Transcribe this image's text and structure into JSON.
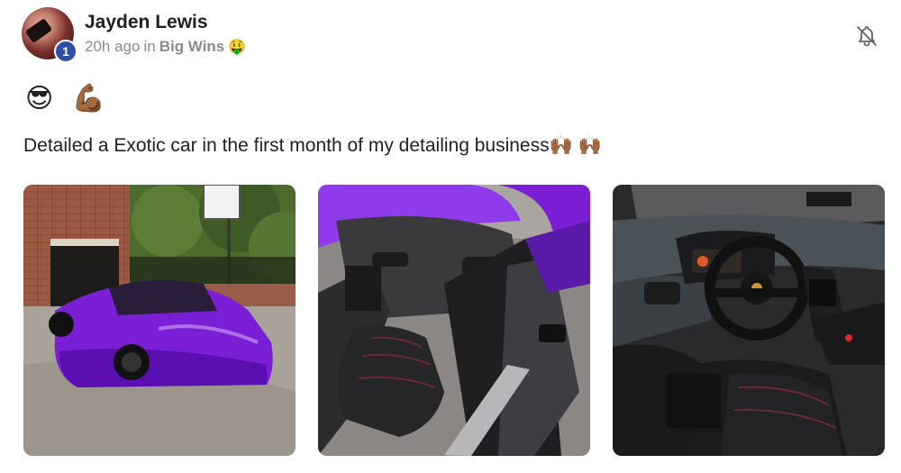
{
  "post": {
    "author": "Jayden Lewis",
    "level": "1",
    "time_ago": "20h ago",
    "in_label": "in",
    "community": "Big Wins",
    "community_emoji": "🤑",
    "emojis": "😎 💪🏾",
    "body": "Detailed a Exotic car in the first month of my detailing business",
    "body_emojis": "🙌🏾 🙌🏾"
  },
  "icons": {
    "notify": "bell-off-icon"
  },
  "photos": [
    {
      "name": "photo-exterior"
    },
    {
      "name": "photo-driver-door-interior"
    },
    {
      "name": "photo-dashboard-interior"
    }
  ],
  "colors": {
    "badge": "#2f4ea3",
    "car_purple": "#7b1fd6",
    "meta_gray": "#8a8a8a"
  }
}
